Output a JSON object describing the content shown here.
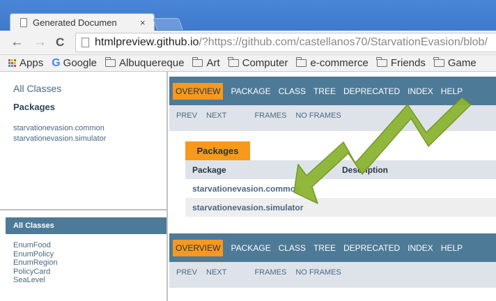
{
  "browser": {
    "tab_title": "Generated Documen",
    "tab_close": "×",
    "url_host": "htmlpreview.github.io",
    "url_rest": "/?https://github.com/castellanos70/StarvationEvasion/blob/",
    "back": "←",
    "forward": "→",
    "reload": "C",
    "bookmarks": [
      {
        "label": "Apps",
        "icon": "apps-grid-icon"
      },
      {
        "label": "Google",
        "icon": "google-g-icon"
      },
      {
        "label": "Albuquereque",
        "icon": "folder-icon"
      },
      {
        "label": "Art",
        "icon": "folder-icon"
      },
      {
        "label": "Computer",
        "icon": "folder-icon"
      },
      {
        "label": "e-commerce",
        "icon": "folder-icon"
      },
      {
        "label": "Friends",
        "icon": "folder-icon"
      },
      {
        "label": "Game",
        "icon": "folder-icon"
      }
    ]
  },
  "left": {
    "all_classes_link": "All Classes",
    "packages_heading": "Packages",
    "packages": [
      "starvationevasion.common",
      "starvationevasion.simulator"
    ],
    "all_classes_bar": "All Classes",
    "classes": [
      "EnumFood",
      "EnumPolicy",
      "EnumRegion",
      "PolicyCard",
      "SeaLevel"
    ]
  },
  "right": {
    "nav": [
      "OVERVIEW",
      "PACKAGE",
      "CLASS",
      "TREE",
      "DEPRECATED",
      "INDEX",
      "HELP"
    ],
    "subnav": {
      "prev": "PREV",
      "next": "NEXT",
      "frames": "FRAMES",
      "noframes": "NO FRAMES"
    },
    "packages_caption": "Packages",
    "table": {
      "headers": [
        "Package",
        "Description"
      ],
      "rows": [
        "starvationevasion.common",
        "starvationevasion.simulator"
      ]
    }
  },
  "colors": {
    "nav_bar": "#4d7a97",
    "active_tab": "#f8981d",
    "subnav_bg": "#dee3e9",
    "annotation_arrow": "#8cb532"
  }
}
